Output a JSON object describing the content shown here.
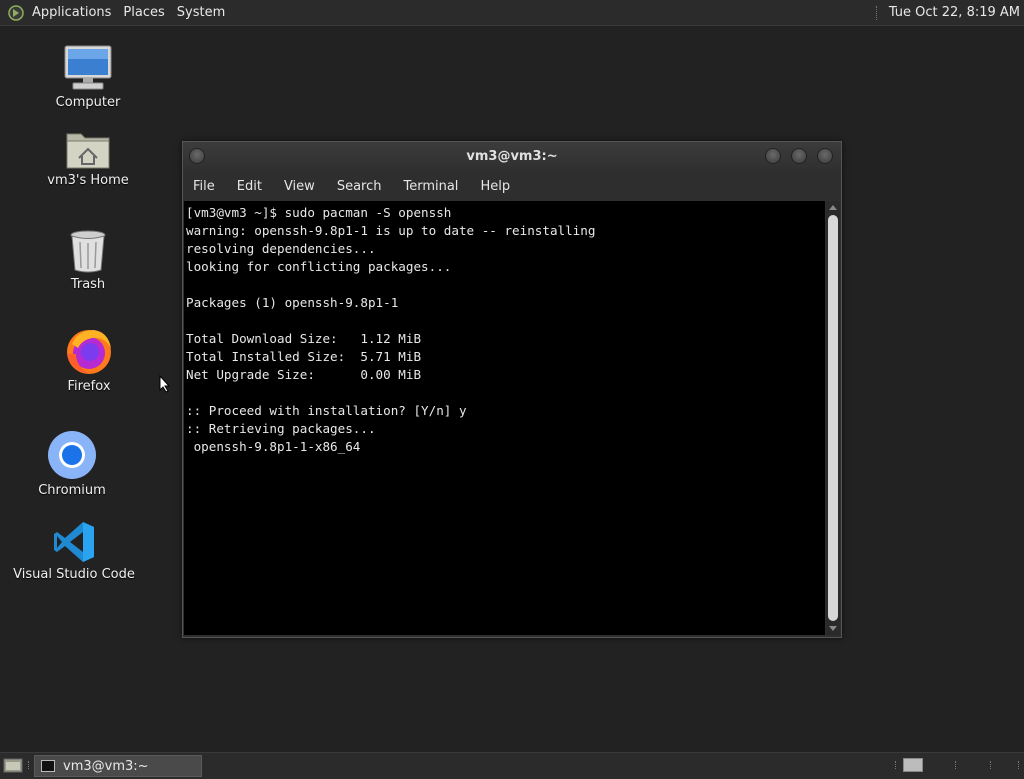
{
  "top_panel": {
    "menus": [
      "Applications",
      "Places",
      "System"
    ],
    "clock": "Tue Oct 22,  8:19 AM"
  },
  "desktop_icons": [
    {
      "label": "Computer",
      "icon": "computer-icon"
    },
    {
      "label": "vm3's Home",
      "icon": "home-folder-icon"
    },
    {
      "label": "Trash",
      "icon": "trash-icon"
    },
    {
      "label": "Firefox",
      "icon": "firefox-icon"
    },
    {
      "label": "Chromium",
      "icon": "chromium-icon"
    },
    {
      "label": "Visual Studio Code",
      "icon": "vscode-icon"
    }
  ],
  "terminal": {
    "title": "vm3@vm3:~",
    "menu": [
      "File",
      "Edit",
      "View",
      "Search",
      "Terminal",
      "Help"
    ],
    "lines": [
      "[vm3@vm3 ~]$ sudo pacman -S openssh",
      "warning: openssh-9.8p1-1 is up to date -- reinstalling",
      "resolving dependencies...",
      "looking for conflicting packages...",
      "",
      "Packages (1) openssh-9.8p1-1",
      "",
      "Total Download Size:   1.12 MiB",
      "Total Installed Size:  5.71 MiB",
      "Net Upgrade Size:      0.00 MiB",
      "",
      ":: Proceed with installation? [Y/n] y",
      ":: Retrieving packages...",
      " openssh-9.8p1-1-x86_64"
    ]
  },
  "taskbar": {
    "task_label": "vm3@vm3:~"
  },
  "colors": {
    "desktop_bg": "#222222",
    "panel_bg": "#2b2b2b",
    "terminal_bg": "#000000"
  }
}
